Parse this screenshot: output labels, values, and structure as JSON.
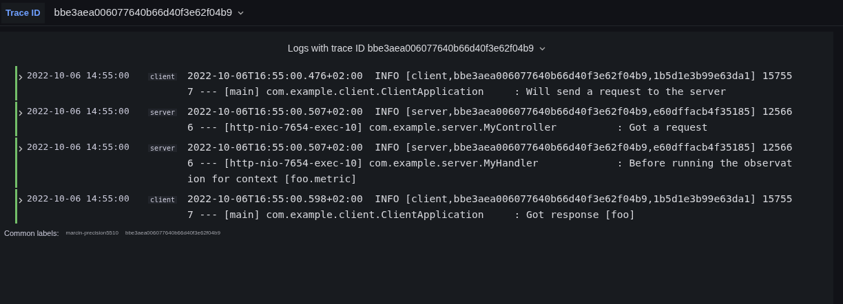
{
  "trace_bar": {
    "label": "Trace ID",
    "value": "bbe3aea006077640b66d40f3e62f04b9"
  },
  "panel": {
    "title": "Logs with trace ID bbe3aea006077640b66d40f3e62f04b9"
  },
  "logs": [
    {
      "time": "2022-10-06 14:55:00",
      "label": "client",
      "message": "2022-10-06T16:55:00.476+02:00  INFO [client,bbe3aea006077640b66d40f3e62f04b9,1b5d1e3b99e63da1] 157557 --- [main] com.example.client.ClientApplication     : Will send a request to the server"
    },
    {
      "time": "2022-10-06 14:55:00",
      "label": "server",
      "message": "2022-10-06T16:55:00.507+02:00  INFO [server,bbe3aea006077640b66d40f3e62f04b9,e60dffacb4f35185] 125666 --- [http-nio-7654-exec-10] com.example.server.MyController          : Got a request"
    },
    {
      "time": "2022-10-06 14:55:00",
      "label": "server",
      "message": "2022-10-06T16:55:00.507+02:00  INFO [server,bbe3aea006077640b66d40f3e62f04b9,e60dffacb4f35185] 125666 --- [http-nio-7654-exec-10] com.example.server.MyHandler             : Before running the observation for context [foo.metric]"
    },
    {
      "time": "2022-10-06 14:55:00",
      "label": "client",
      "message": "2022-10-06T16:55:00.598+02:00  INFO [client,bbe3aea006077640b66d40f3e62f04b9,1b5d1e3b99e63da1] 157557 --- [main] com.example.client.ClientApplication     : Got response [foo]"
    }
  ],
  "common_labels": {
    "title": "Common labels:",
    "values": [
      "marcin-precision5510",
      "bbe3aea006077640b66d40f3e62f04b9"
    ]
  }
}
